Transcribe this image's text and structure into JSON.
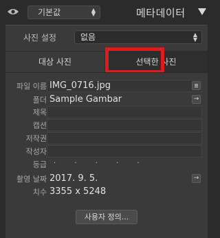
{
  "header": {
    "preset_value": "기본값",
    "panel_title": "메타데이터"
  },
  "photo_setting": {
    "label": "사진 설정",
    "value": "없음"
  },
  "tabs": [
    {
      "label": "대상 사진"
    },
    {
      "label": "선택한 사진"
    }
  ],
  "fields": [
    {
      "label": "파일 이름",
      "value": "IMG_0716.jpg"
    },
    {
      "label": "폴더",
      "value": "Sample Gambar"
    },
    {
      "label": "제목",
      "value": ""
    },
    {
      "label": "캡션",
      "value": ""
    },
    {
      "label": "저작권",
      "value": ""
    },
    {
      "label": "작성자",
      "value": ""
    },
    {
      "label": "등급",
      "value": "· · · · ·"
    },
    {
      "label": "촬영 날짜",
      "value": "2017. 9. 5."
    },
    {
      "label": "치수",
      "value": "3355 x 5248"
    }
  ],
  "custom_button": "사용자 정의...",
  "icons": {
    "visibility": "eye-icon",
    "dropdown": "updown-arrows-icon",
    "collapse": "triangle-down-icon",
    "menu": "list-icon",
    "go": "arrow-right-icon"
  },
  "colors": {
    "highlight": "#e11b1b",
    "panel_bg": "#3a3a3a",
    "page_bg": "#2b2b2b"
  }
}
